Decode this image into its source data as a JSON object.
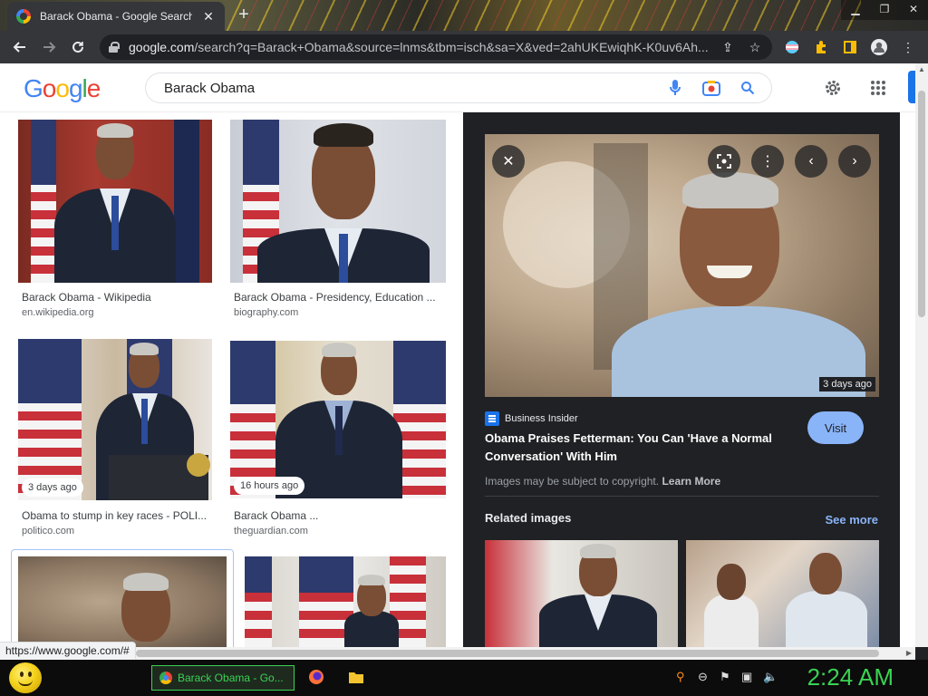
{
  "browser": {
    "tab_title": "Barack Obama - Google Search",
    "tab_close": "✕",
    "new_tab": "+",
    "url_host": "google.com",
    "url_path": "/search?q=Barack+Obama&source=lnms&tbm=isch&sa=X&ved=2ahUKEwiqhK-K0uv6Ah...",
    "window_controls": [
      "▁",
      "❐",
      "✕"
    ]
  },
  "google": {
    "logo": [
      "G",
      "o",
      "o",
      "g",
      "l",
      "e"
    ],
    "search_query": "Barack Obama"
  },
  "results": [
    {
      "title": "Barack Obama - Wikipedia",
      "source": "en.wikipedia.org",
      "badge": ""
    },
    {
      "title": "Barack Obama - Presidency, Education ...",
      "source": "biography.com",
      "badge": ""
    },
    {
      "title": "Obama to stump in key races - POLI...",
      "source": "politico.com",
      "badge": "3 days ago"
    },
    {
      "title": "Barack Obama ...",
      "source": "theguardian.com",
      "badge": "16 hours ago"
    }
  ],
  "preview": {
    "badge": "3 days ago",
    "source_name": "Business Insider",
    "title": "Obama Praises Fetterman: You Can 'Have a Normal Conversation' With Him",
    "visit_label": "Visit",
    "copyright_text": "Images may be subject to copyright.",
    "learn_more": "Learn More",
    "related_label": "Related images",
    "see_more": "See more"
  },
  "status_url": "https://www.google.com/#",
  "taskbar": {
    "task_label": "Barack Obama - Go...",
    "clock": "2:24 AM"
  }
}
